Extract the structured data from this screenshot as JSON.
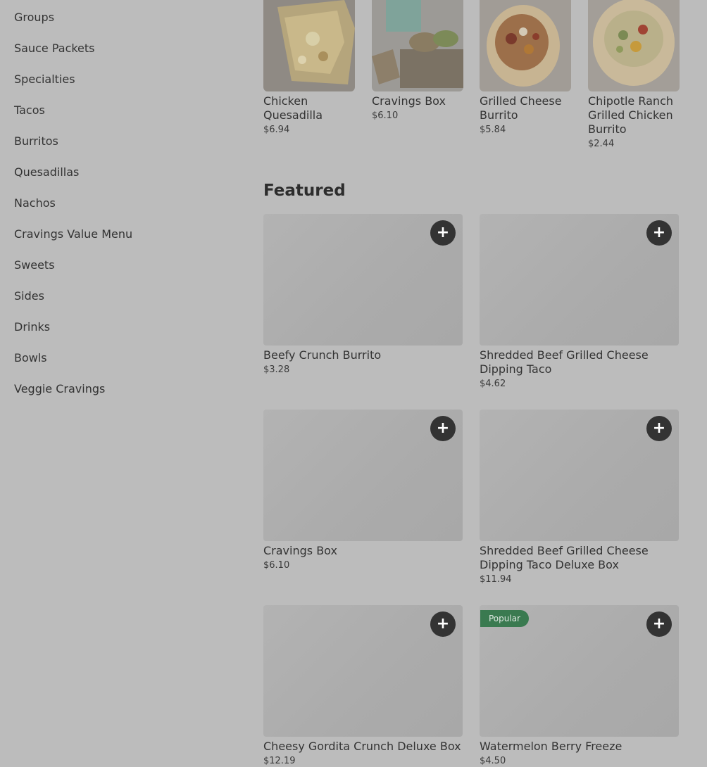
{
  "sidebar": {
    "items": [
      {
        "label": "Groups"
      },
      {
        "label": "Sauce Packets"
      },
      {
        "label": "Specialties"
      },
      {
        "label": "Tacos"
      },
      {
        "label": "Burritos"
      },
      {
        "label": "Quesadillas"
      },
      {
        "label": "Nachos"
      },
      {
        "label": "Cravings Value Menu"
      },
      {
        "label": "Sweets"
      },
      {
        "label": "Sides"
      },
      {
        "label": "Drinks"
      },
      {
        "label": "Bowls"
      },
      {
        "label": "Veggie Cravings"
      }
    ]
  },
  "top_row": [
    {
      "name": "Chicken Quesadilla",
      "price": "$6.94"
    },
    {
      "name": "Cravings Box",
      "price": "$6.10"
    },
    {
      "name": "Grilled Cheese Burrito",
      "price": "$5.84"
    },
    {
      "name": "Chipotle Ranch Grilled Chicken Burrito",
      "price": "$2.44"
    }
  ],
  "featured": {
    "title": "Featured",
    "items": [
      {
        "name": "Beefy Crunch Burrito",
        "price": "$3.28",
        "add_label": "+"
      },
      {
        "name": "Shredded Beef Grilled Cheese Dipping Taco",
        "price": "$4.62",
        "add_label": "+"
      },
      {
        "name": "Cravings Box",
        "price": "$6.10",
        "add_label": "+"
      },
      {
        "name": "Shredded Beef Grilled Cheese Dipping Taco Deluxe Box",
        "price": "$11.94",
        "add_label": "+"
      },
      {
        "name": "Cheesy Gordita Crunch Deluxe Box",
        "price": "$12.19",
        "add_label": "+"
      },
      {
        "name": "Watermelon Berry Freeze",
        "price": "$4.50",
        "add_label": "+",
        "badge": "Popular"
      }
    ]
  },
  "colors": {
    "overlay_background": "#bcbcbc",
    "add_button": "#333333",
    "popular_badge": "#3a7a50"
  }
}
